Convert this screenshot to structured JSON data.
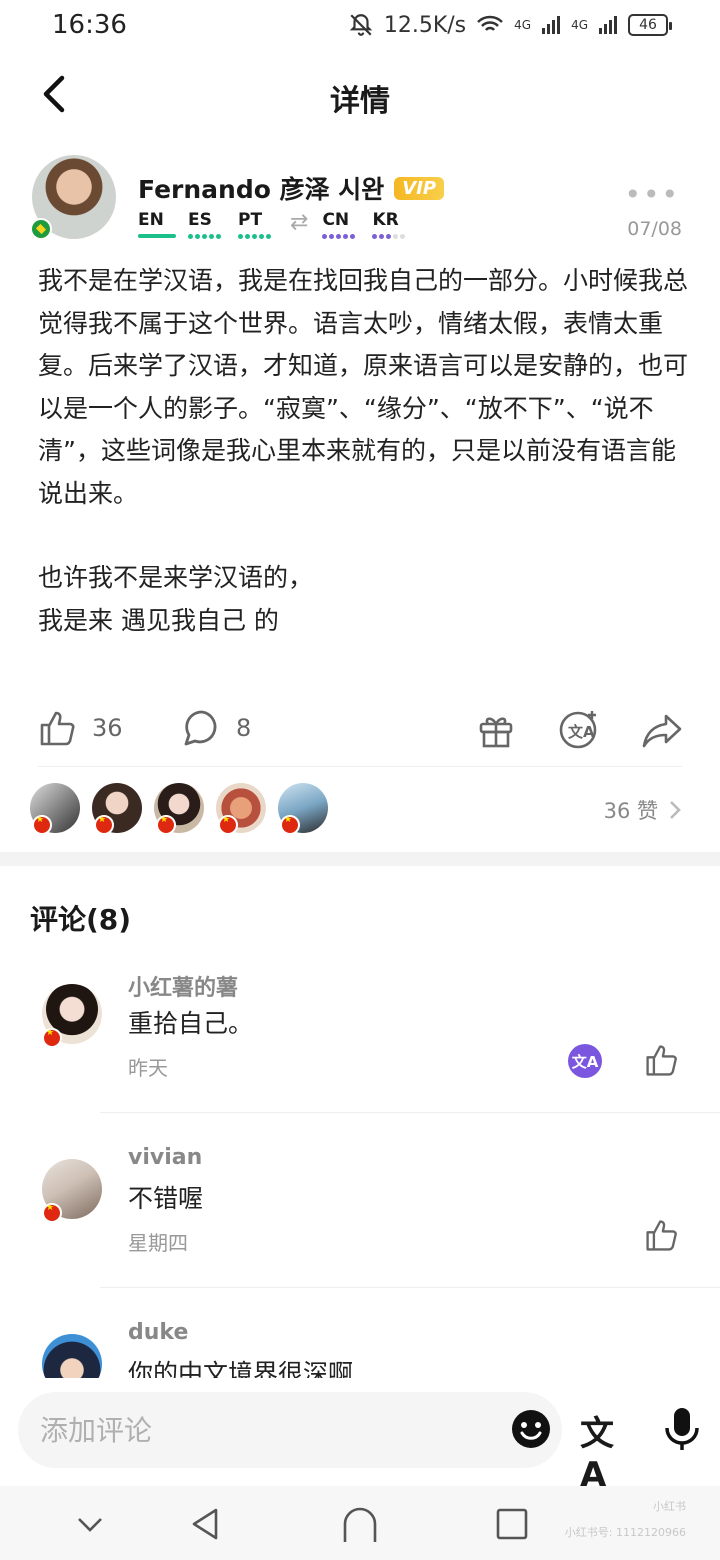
{
  "status_bar": {
    "time": "16:36",
    "net_speed": "12.5K/s",
    "signal_1": "4G",
    "signal_2": "4G",
    "battery": "46"
  },
  "header": {
    "title": "详情"
  },
  "post": {
    "author": {
      "name": "Fernando 彦泽 시완",
      "badge": "VIP",
      "languages": [
        {
          "code": "EN",
          "color": "#1bbf8a",
          "type": "native"
        },
        {
          "code": "ES",
          "color": "#1bbf8a",
          "type": "dots"
        },
        {
          "code": "PT",
          "color": "#1bbf8a",
          "type": "dots"
        },
        {
          "code": "CN",
          "color": "#7a5fd6",
          "type": "dots"
        },
        {
          "code": "KR",
          "color": "#7a5fd6",
          "type": "dots-partial"
        }
      ]
    },
    "date": "07/08",
    "paragraphs": [
      "我不是在学汉语，我是在找回我自己的一部分。小时候我总觉得我不属于这个世界。语言太吵，情绪太假，表情太重复。后来学了汉语，才知道，原来语言可以是安静的，也可以是一个人的影子。“寂寞”、“缘分”、“放不下”、“说不清”，这些词像是我心里本来就有的，只是以前没有语言能说出来。",
      "也许我不是来学汉语的，\n我是来 遇见我自己 的"
    ],
    "likes": "36",
    "comments": "8",
    "likers_summary": "36 赞"
  },
  "comments_section": {
    "title": "评论(8)",
    "items": [
      {
        "name": "小红薯的薯",
        "text": "重拾自己。",
        "time": "昨天"
      },
      {
        "name": "vivian",
        "text": "不错喔",
        "time": "星期四"
      },
      {
        "name": "duke",
        "text": "你的中文境界很深啊",
        "time": ""
      }
    ]
  },
  "composer": {
    "placeholder": "添加评论",
    "translate_glyph": "文A"
  },
  "watermark": {
    "line1": "小红书",
    "line2": "小红书号: 1112120966"
  },
  "colors": {
    "accent_green": "#1bbf8a",
    "accent_purple": "#7a5fd6",
    "vip_gold": "#f5b722"
  }
}
